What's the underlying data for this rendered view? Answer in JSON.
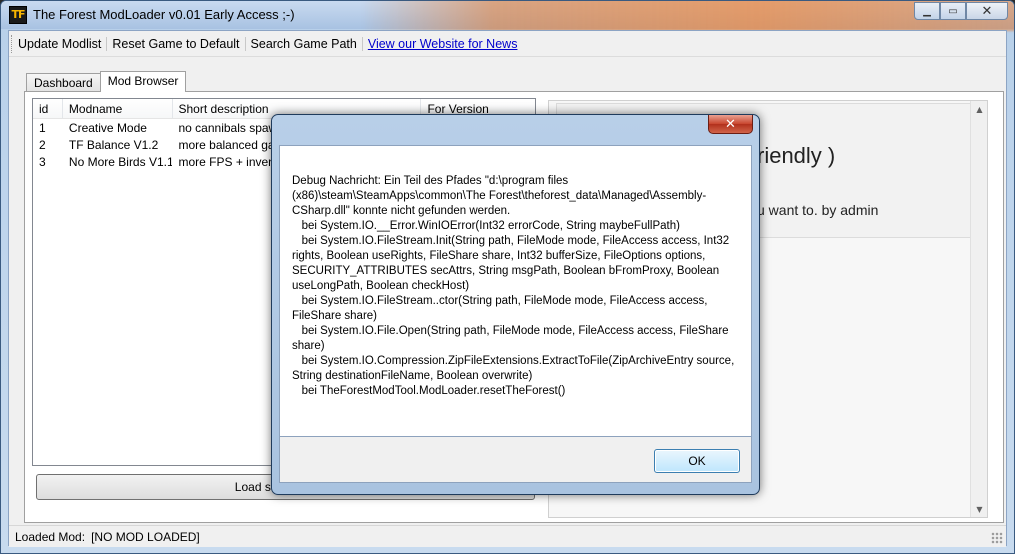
{
  "window": {
    "title": "The Forest ModLoader v0.01 Early Access ;-)",
    "icon_text": "TF",
    "minimize_glyph": "▁",
    "maximize_glyph": "▭",
    "close_glyph": "✕"
  },
  "menubar": {
    "items": [
      {
        "label": "Update Modlist"
      },
      {
        "label": "Reset Game to Default"
      },
      {
        "label": "Search Game Path"
      },
      {
        "label": "View our Website for News"
      }
    ]
  },
  "tabs": [
    {
      "label": "Dashboard",
      "active": false
    },
    {
      "label": "Mod Browser",
      "active": true
    }
  ],
  "modlist": {
    "columns": [
      "id",
      "Modname",
      "Short description",
      "For Version"
    ],
    "rows": [
      {
        "id": "1",
        "name": "Creative Mode",
        "desc": "no cannibals spawn...",
        "version": ""
      },
      {
        "id": "2",
        "name": "TF Balance V1.2",
        "desc": "more balanced game...",
        "version": ""
      },
      {
        "id": "3",
        "name": "No More Birds V1.1",
        "desc": "more FPS + inventory...",
        "version": ""
      }
    ],
    "load_button": "Load selected Mod"
  },
  "detail": {
    "title": "riendly )",
    "subtitle": "u want to. by admin"
  },
  "statusbar": {
    "label": "Loaded Mod:",
    "value": "[NO MOD LOADED]"
  },
  "dialog": {
    "close_glyph": "✕",
    "message": "Debug Nachricht: Ein Teil des Pfades \"d:\\program files (x86)\\steam\\SteamApps\\common\\The Forest\\theforest_data\\Managed\\Assembly-CSharp.dll\" konnte nicht gefunden werden.\n   bei System.IO.__Error.WinIOError(Int32 errorCode, String maybeFullPath)\n   bei System.IO.FileStream.Init(String path, FileMode mode, FileAccess access, Int32 rights, Boolean useRights, FileShare share, Int32 bufferSize, FileOptions options, SECURITY_ATTRIBUTES secAttrs, String msgPath, Boolean bFromProxy, Boolean useLongPath, Boolean checkHost)\n   bei System.IO.FileStream..ctor(String path, FileMode mode, FileAccess access, FileShare share)\n   bei System.IO.File.Open(String path, FileMode mode, FileAccess access, FileShare share)\n   bei System.IO.Compression.ZipFileExtensions.ExtractToFile(ZipArchiveEntry source, String destinationFileName, Boolean overwrite)\n   bei TheForestModTool.ModLoader.resetTheForest()",
    "ok_label": "OK"
  }
}
